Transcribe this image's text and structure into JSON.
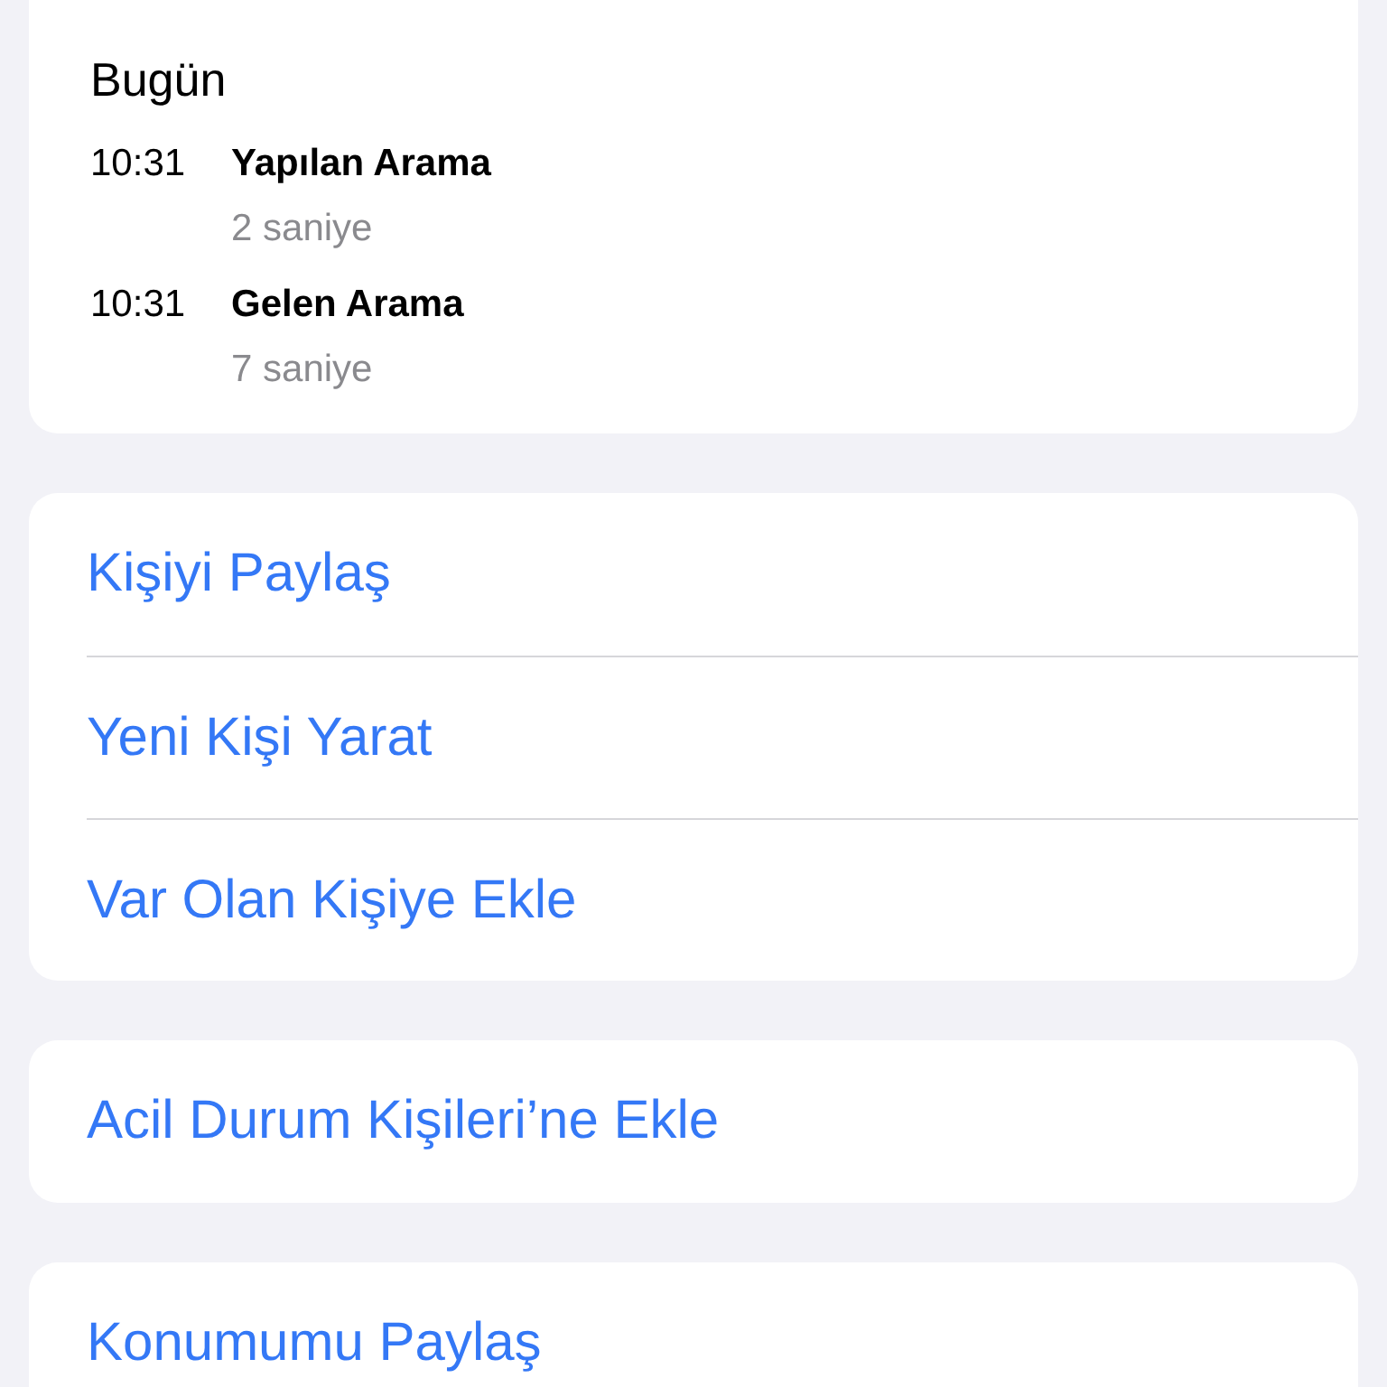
{
  "recents": {
    "heading": "Bugün",
    "calls": [
      {
        "time": "10:31",
        "type": "Yapılan Arama",
        "duration": "2 saniye"
      },
      {
        "time": "10:31",
        "type": "Gelen Arama",
        "duration": "7 saniye"
      }
    ]
  },
  "action_groups": [
    {
      "actions": [
        "Kişiyi Paylaş",
        "Yeni Kişi Yarat",
        "Var Olan Kişiye Ekle"
      ]
    },
    {
      "actions": [
        "Acil Durum Kişileri’ne Ekle"
      ]
    },
    {
      "actions": [
        "Konumumu Paylaş"
      ]
    }
  ]
}
